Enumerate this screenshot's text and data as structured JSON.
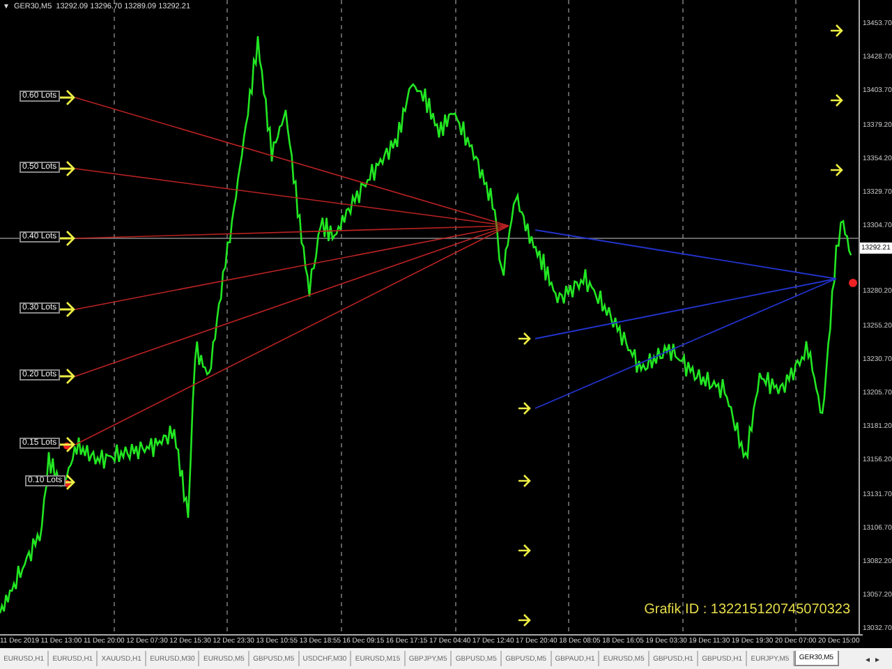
{
  "header": {
    "menu_glyph": "▼",
    "symbol": "GER30,M5",
    "quote": "13292.09 13296.70 13289.09 13292.21"
  },
  "lot_labels": [
    "0.60 Lots",
    "0.50 Lots",
    "0.40 Lots",
    "0.30 Lots",
    "0.20 Lots",
    "0.15 Lots",
    "0.10 Lots"
  ],
  "grafik_id": "Grafik ID : 132215120745070323",
  "price_axis": {
    "labels": [
      "13453.70",
      "13428.70",
      "13403.70",
      "13379.20",
      "13354.20",
      "13329.70",
      "13304.70",
      "13280.20",
      "13255.20",
      "13230.70",
      "13205.70",
      "13181.20",
      "13156.20",
      "13131.70",
      "13106.70",
      "13082.20",
      "13057.20",
      "13032.70"
    ],
    "current_price": "13292.21"
  },
  "time_axis": [
    "11 Dec 2019",
    "11 Dec 13:00",
    "11 Dec 20:00",
    "12 Dec 07:30",
    "12 Dec 15:30",
    "12 Dec 23:30",
    "13 Dec 10:55",
    "13 Dec 18:55",
    "16 Dec 09:15",
    "16 Dec 17:15",
    "17 Dec 04:40",
    "17 Dec 12:40",
    "17 Dec 20:40",
    "18 Dec 08:05",
    "18 Dec 16:05",
    "19 Dec 03:30",
    "19 Dec 11:30",
    "19 Dec 19:30",
    "20 Dec 07:00",
    "20 Dec 15:00"
  ],
  "tabs": [
    {
      "label": "EURUSD,H1",
      "selected": false
    },
    {
      "label": "EURUSD,H1",
      "selected": false
    },
    {
      "label": "XAUUSD,H1",
      "selected": false
    },
    {
      "label": "EURUSD,M30",
      "selected": false
    },
    {
      "label": "EURUSD,M5",
      "selected": false
    },
    {
      "label": "GBPUSD,M5",
      "selected": false
    },
    {
      "label": "USDCHF,M30",
      "selected": false
    },
    {
      "label": "EURUSD,M15",
      "selected": false
    },
    {
      "label": "GBPJPY,M5",
      "selected": false
    },
    {
      "label": "GBPUSD,M5",
      "selected": false
    },
    {
      "label": "GBPUSD,M5",
      "selected": false
    },
    {
      "label": "GBPAUD,H1",
      "selected": false
    },
    {
      "label": "EURUSD,M5",
      "selected": false
    },
    {
      "label": "GBPUSD,H1",
      "selected": false
    },
    {
      "label": "GBPUSD,H1",
      "selected": false
    },
    {
      "label": "EURJPY,M5",
      "selected": false
    },
    {
      "label": "GER30,M5",
      "selected": true
    }
  ],
  "tab_scroll": [
    "◂",
    "▸"
  ]
}
